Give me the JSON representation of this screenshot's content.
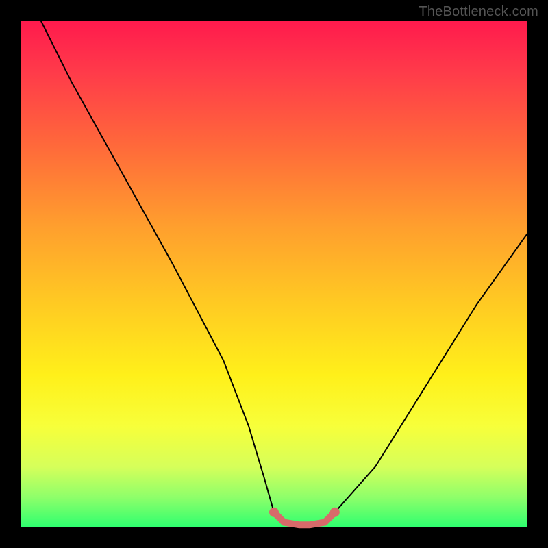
{
  "watermark": "TheBottleneck.com",
  "chart_data": {
    "type": "line",
    "title": "",
    "xlabel": "",
    "ylabel": "",
    "xlim": [
      0,
      100
    ],
    "ylim": [
      0,
      100
    ],
    "series": [
      {
        "name": "bottleneck-curve",
        "x": [
          4,
          10,
          20,
          30,
          40,
          45,
          48,
          50,
          52,
          55,
          57,
          60,
          62,
          70,
          80,
          90,
          100
        ],
        "values": [
          100,
          88,
          70,
          52,
          33,
          20,
          10,
          3,
          1,
          0.5,
          0.5,
          1,
          3,
          12,
          28,
          44,
          58
        ]
      },
      {
        "name": "highlight-range",
        "x": [
          50,
          52,
          55,
          57,
          60,
          62
        ],
        "values": [
          3,
          1,
          0.5,
          0.5,
          1,
          3
        ]
      }
    ],
    "background_gradient": {
      "top": "#ff1a4d",
      "mid": "#fff01a",
      "bottom": "#2dff6f"
    },
    "highlight_color": "#d76a6a",
    "curve_color": "#000000"
  }
}
